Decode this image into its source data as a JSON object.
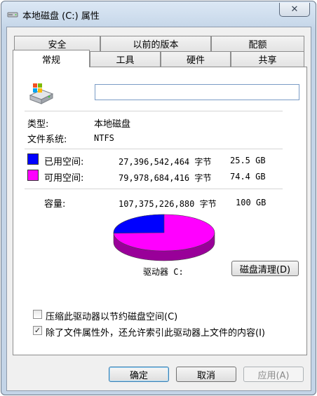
{
  "window": {
    "title": "本地磁盘 (C:) 属性",
    "close_glyph": "✕"
  },
  "tabs_row1": [
    "安全",
    "以前的版本",
    "配额"
  ],
  "tabs_row2": [
    "常规",
    "工具",
    "硬件",
    "共享"
  ],
  "active_tab": "常规",
  "general": {
    "name_value": "",
    "type_label": "类型:",
    "type_value": "本地磁盘",
    "fs_label": "文件系统:",
    "fs_value": "NTFS",
    "used": {
      "label": "已用空间:",
      "bytes": "27,396,542,464 字节",
      "size": "25.5 GB",
      "color": "#0000ff"
    },
    "free": {
      "label": "可用空间:",
      "bytes": "79,978,684,416 字节",
      "size": "74.4 GB",
      "color": "#ff00ff"
    },
    "capacity": {
      "label": "容量:",
      "bytes": "107,375,226,880 字节",
      "size": "100 GB"
    },
    "drive_label": "驱动器 C:",
    "cleanup_button": "磁盘清理(D)",
    "used_fraction": 0.255,
    "compress_label": "压缩此驱动器以节约磁盘空间(C)",
    "compress_checked": false,
    "index_label": "除了文件属性外，还允许索引此驱动器上文件的内容(I)",
    "index_checked": true
  },
  "buttons": {
    "ok": "确定",
    "cancel": "取消",
    "apply": "应用(A)"
  },
  "icons": {
    "title": "drive-icon",
    "drive": "hard-drive-icon"
  }
}
